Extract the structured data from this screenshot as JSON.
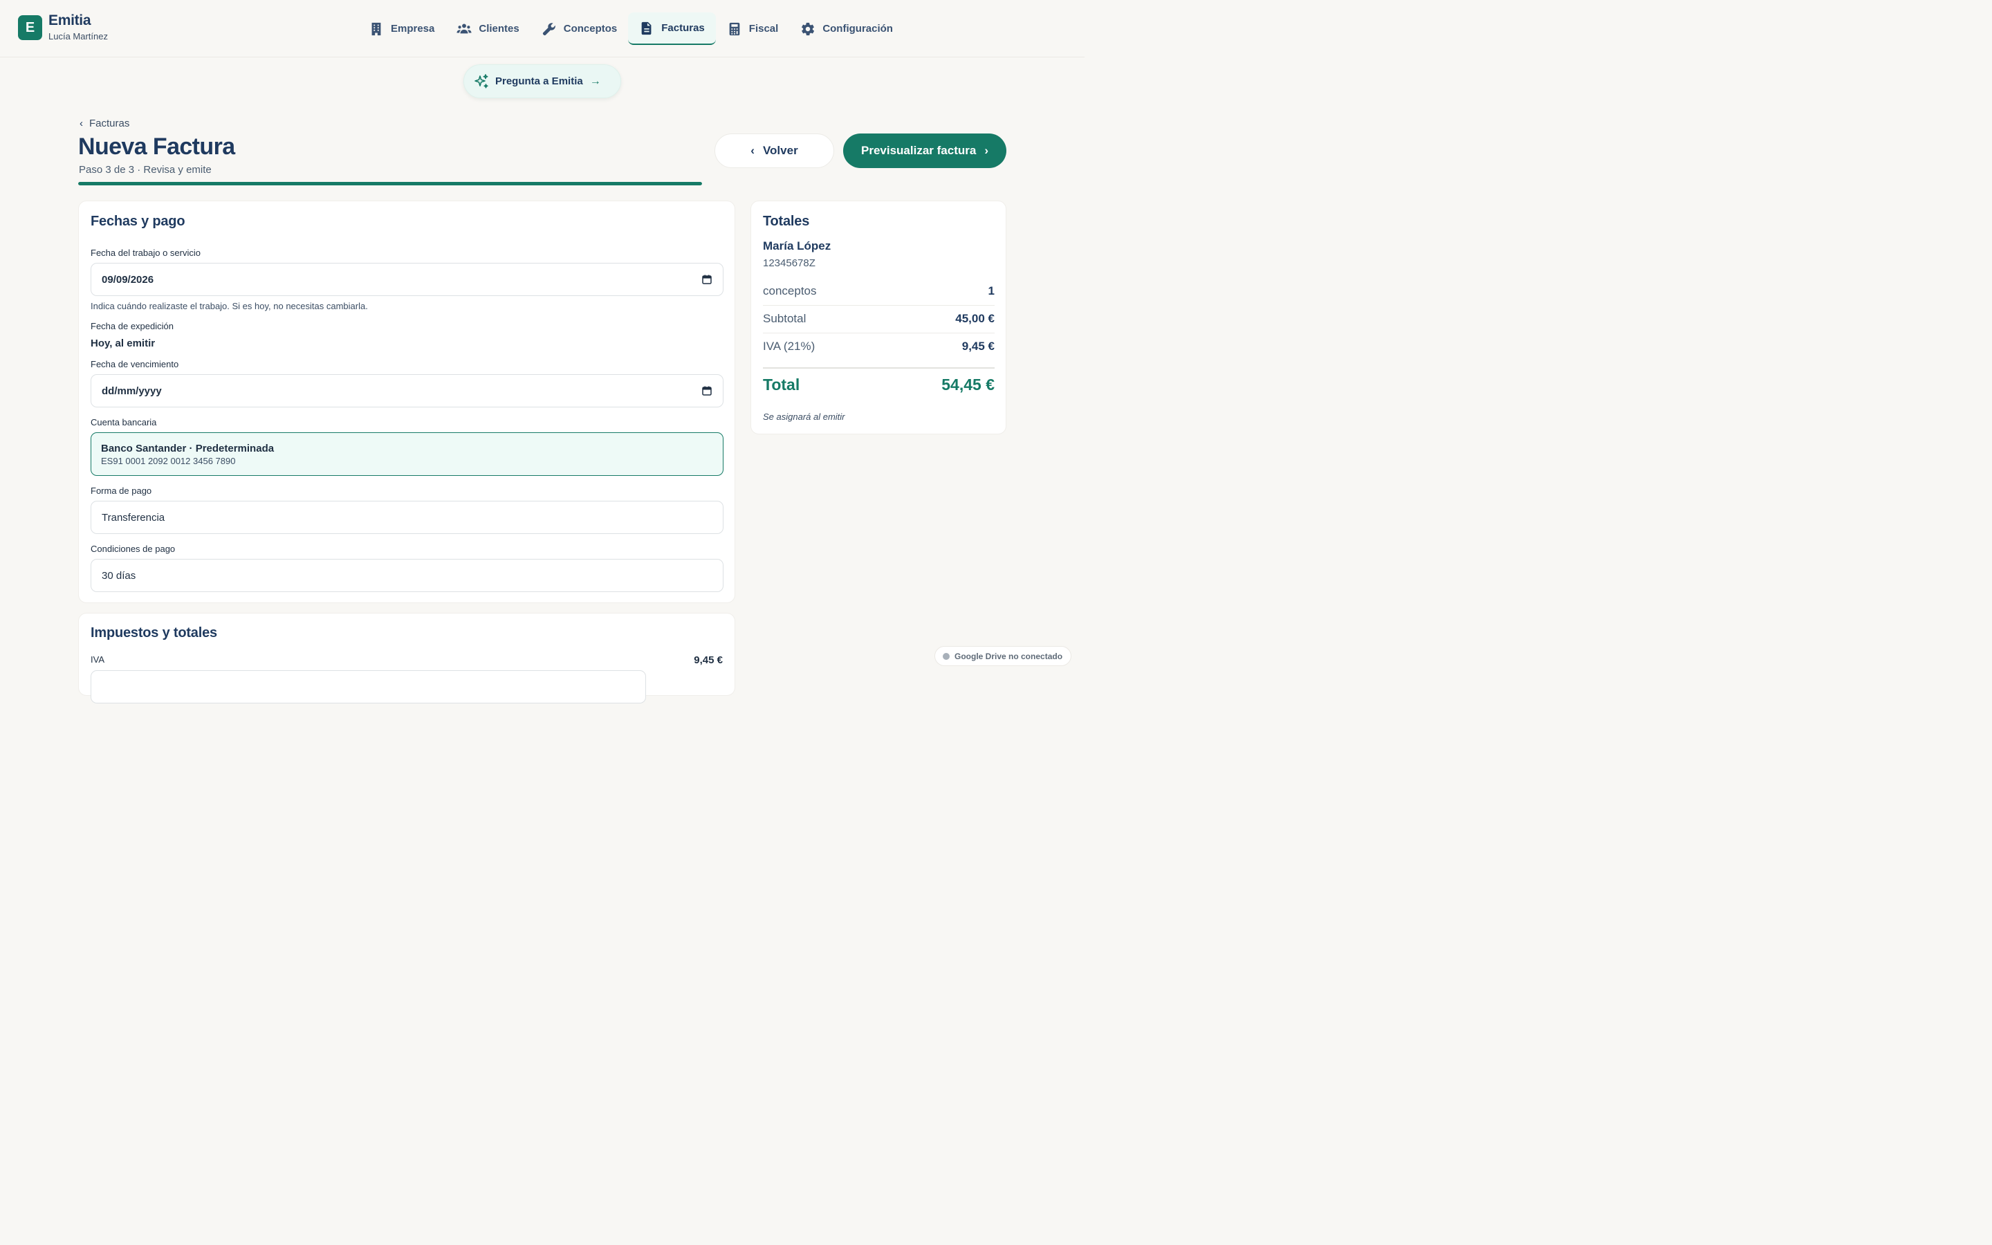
{
  "brand": {
    "initial": "E",
    "name": "Emitia",
    "user": "Lucía Martínez"
  },
  "nav": [
    {
      "label": "Empresa",
      "icon": "building-icon",
      "active": false
    },
    {
      "label": "Clientes",
      "icon": "users-icon",
      "active": false
    },
    {
      "label": "Conceptos",
      "icon": "wrench-icon",
      "active": false
    },
    {
      "label": "Facturas",
      "icon": "document-icon",
      "active": true
    },
    {
      "label": "Fiscal",
      "icon": "calculator-icon",
      "active": false
    },
    {
      "label": "Configuración",
      "icon": "gear-icon",
      "active": false
    }
  ],
  "ask": {
    "label": "Pregunta a Emitia",
    "icon": "sparkle-icon"
  },
  "header": {
    "breadcrumb": "Facturas",
    "title": "Nueva Factura",
    "step": "Paso 3 de 3 · Revisa y emite",
    "progress": 1.0,
    "back_label": "Volver",
    "preview_label": "Previsualizar factura"
  },
  "form": {
    "title": "Fechas y pago",
    "work_date": {
      "label": "Fecha del trabajo o servicio",
      "value": "09/09/2026",
      "hint": "Indica cuándo realizaste el trabajo. Si es hoy, no necesitas cambiarla."
    },
    "issue_date": {
      "label": "Fecha de expedición",
      "value": "Hoy, al emitir"
    },
    "due_date": {
      "label": "Fecha de vencimiento",
      "value": "dd/mm/yyyy"
    },
    "bank": {
      "label": "Cuenta bancaria",
      "name": "Banco Santander · Predeterminada",
      "iban": "ES91 0001 2092 0012 3456 7890"
    },
    "payment_method": {
      "label": "Forma de pago",
      "value": "Transferencia"
    },
    "payment_terms": {
      "label": "Condiciones de pago",
      "value": "30 días"
    }
  },
  "taxes": {
    "title": "Impuestos y totales",
    "iva_label": "IVA",
    "iva_amount": "9,45 €"
  },
  "totals": {
    "title": "Totales",
    "client_name": "María López",
    "client_nif": "12345678Z",
    "rows": [
      {
        "label": "conceptos",
        "value": "1"
      },
      {
        "label": "Subtotal",
        "value": "45,00 €"
      },
      {
        "label": "IVA (21%)",
        "value": "9,45 €"
      }
    ],
    "total_label": "Total",
    "total_value": "54,45 €",
    "note": "Se asignará al emitir"
  },
  "drive": {
    "status": "Google Drive no conectado"
  },
  "colors": {
    "accent": "#167a66",
    "text": "#1f3a5f",
    "background": "#f8f7f4"
  }
}
